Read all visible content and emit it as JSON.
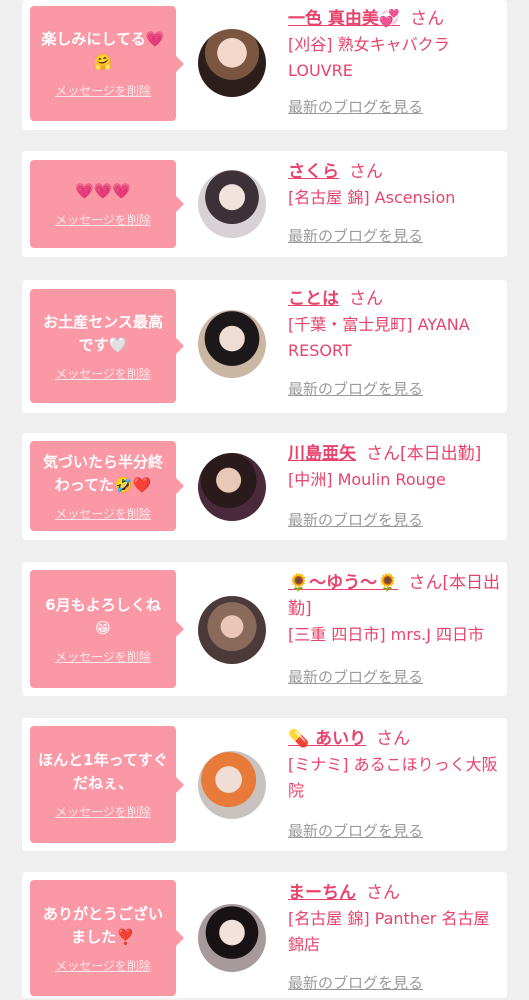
{
  "common": {
    "delete_label": "メッセージを削除",
    "san_label": "さん",
    "blog_label": "最新のブログを見る"
  },
  "cards": [
    {
      "message": "楽しみにしてる💗🤗",
      "name": "一色 真由美💞",
      "status": "",
      "shop": "[刈谷] 熟女キャバクラ LOUVRE"
    },
    {
      "message": "💗💗💗",
      "name": "さくら",
      "status": "",
      "shop": "[名古屋 錦] Ascension"
    },
    {
      "message": "お土産センス最高です🤍",
      "name": "ことは",
      "status": "",
      "shop": "[千葉・富士見町] AYANA RESORT"
    },
    {
      "message": "気づいたら半分終わってた🤣❤️",
      "name": "川島亜矢",
      "status": "[本日出勤]",
      "shop": "[中洲] Moulin Rouge"
    },
    {
      "message": "6月もよろしくね😁",
      "name": "🌻〜ゆう〜🌻",
      "status": "[本日出勤]",
      "shop": "[三重 四日市] mrs.J 四日市"
    },
    {
      "message": "ほんと1年ってすぐだねぇ、",
      "name": "💊 あいり",
      "status": "",
      "shop": "[ミナミ] あるこほりっく大阪院"
    },
    {
      "message": "ありがとうございました❣️",
      "name": "まーちん",
      "status": "",
      "shop": "[名古屋 錦] Panther 名古屋錦店"
    }
  ],
  "colors": {
    "bubble": "#fb98a6",
    "name": "#e8436c",
    "link": "#9a9a9a"
  }
}
